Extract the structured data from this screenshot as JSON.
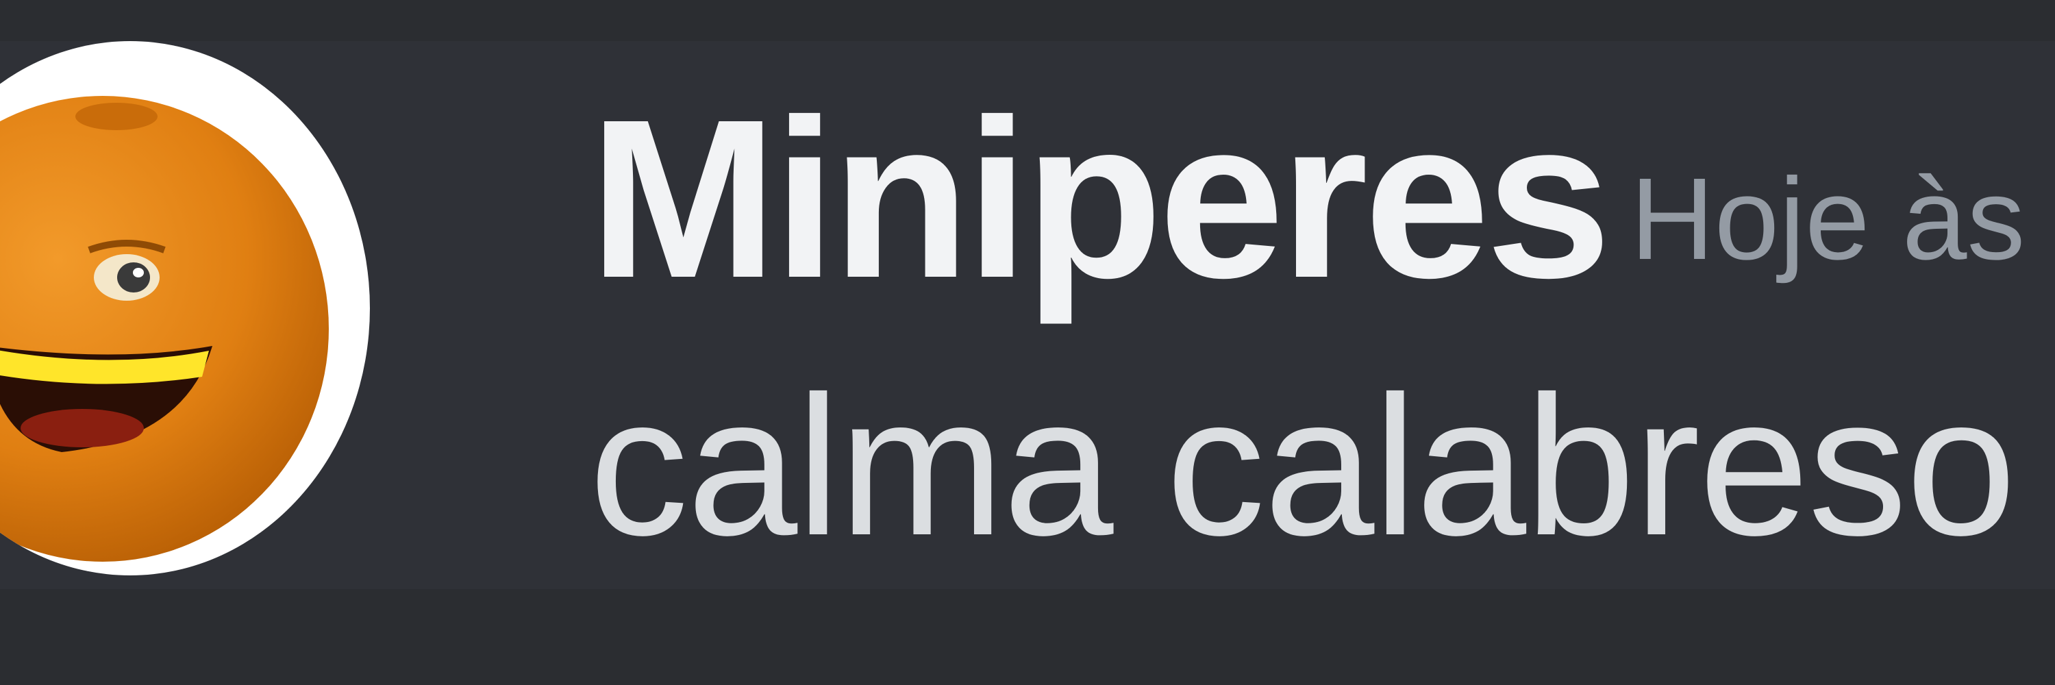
{
  "message": {
    "author": "Miniperes",
    "timestamp": "Hoje às",
    "content": "calma calabreso",
    "avatar_icon": "orange-face-avatar"
  },
  "colors": {
    "background": "#2f3137",
    "username": "#f2f3f5",
    "timestamp": "#949ba4",
    "content": "#dbdee1",
    "avatar_orange": "#e07f12"
  }
}
